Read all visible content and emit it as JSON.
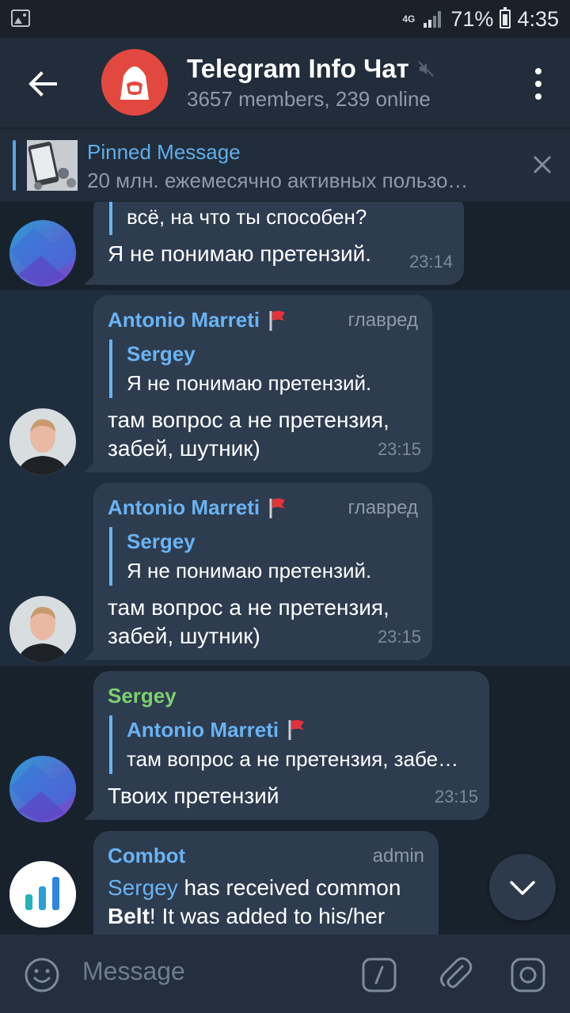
{
  "status_bar": {
    "network": "4G",
    "battery": "71%",
    "time": "4:35"
  },
  "header": {
    "title": "Telegram Info Чат",
    "subtitle": "3657 members, 239 online"
  },
  "pinned": {
    "title": "Pinned Message",
    "text": "20 млн. ежемесячно активных пользо…"
  },
  "messages": [
    {
      "quote_text": "всё, на что ты способен?",
      "text": "Я не понимаю претензий.",
      "time": "23:14"
    },
    {
      "author": "Antonio Marreti",
      "role": "главред",
      "reply_author": "Sergey",
      "reply_text": "Я не понимаю претензий.",
      "text_line1": "там вопрос а не претензия,",
      "text_line2": "забей, шутник)",
      "time": "23:15"
    },
    {
      "author": "Antonio Marreti",
      "role": "главред",
      "reply_author": "Sergey",
      "reply_text": "Я не понимаю претензий.",
      "text_line1": "там вопрос а не претензия,",
      "text_line2": "забей, шутник)",
      "time": "23:15"
    },
    {
      "author": "Sergey",
      "reply_author": "Antonio Marreti",
      "reply_text": "там вопрос а не претензия, забе…",
      "text": "Твоих претензий",
      "time": "23:15"
    },
    {
      "author": "Combot",
      "role": "admin",
      "mention": "Sergey",
      "text_part1": " has received common",
      "bold": "Belt",
      "text_part2": "! It was added to his/her"
    }
  ],
  "input": {
    "placeholder": "Message"
  },
  "colors": {
    "accent": "#6ab3f3",
    "green_name": "#7dd06e",
    "bubble": "#2d3c4f",
    "background": "#18222d",
    "header": "#212d3b"
  }
}
